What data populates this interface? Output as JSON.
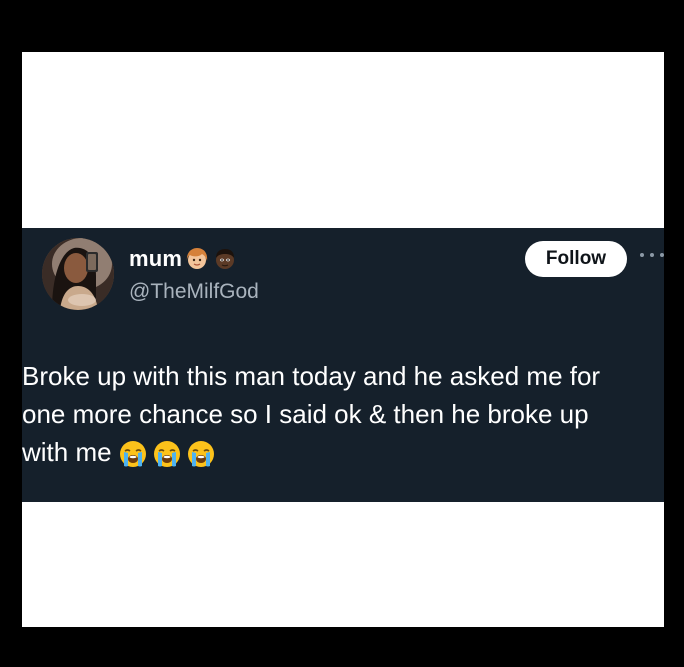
{
  "user": {
    "name": "mum",
    "name_emojis": [
      "girl-face-emoji",
      "boy-face-emoji"
    ],
    "handle": "@TheMilfGod"
  },
  "actions": {
    "follow_label": "Follow"
  },
  "tweet": {
    "text_line1": "Broke up with this man today and he asked me for",
    "text_line2": "one more chance so I said ok & then he broke up",
    "text_line3": "with me",
    "emojis": [
      "loudly-crying-face-emoji",
      "loudly-crying-face-emoji",
      "loudly-crying-face-emoji"
    ]
  },
  "colors": {
    "background": "#000000",
    "frame": "#ffffff",
    "tweet_bg": "#15202b",
    "text": "#ffffff",
    "handle": "#a9b3bd"
  }
}
